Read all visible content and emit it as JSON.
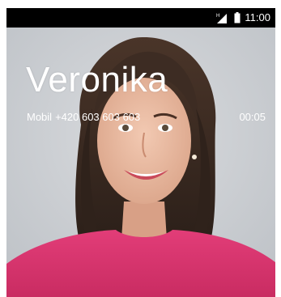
{
  "status_bar": {
    "signal_icon": "signal-icon",
    "battery_icon": "battery-icon",
    "time": "11:00"
  },
  "call": {
    "caller_name": "Veronika",
    "phone_type": "Mobil",
    "phone_number": "+420 603 603 603",
    "duration": "00:05",
    "photo": "caller-photo"
  },
  "colors": {
    "status_bar_bg": "#000000",
    "text": "#ffffff",
    "shirt": "#d8326e",
    "hair": "#3a2a22"
  }
}
